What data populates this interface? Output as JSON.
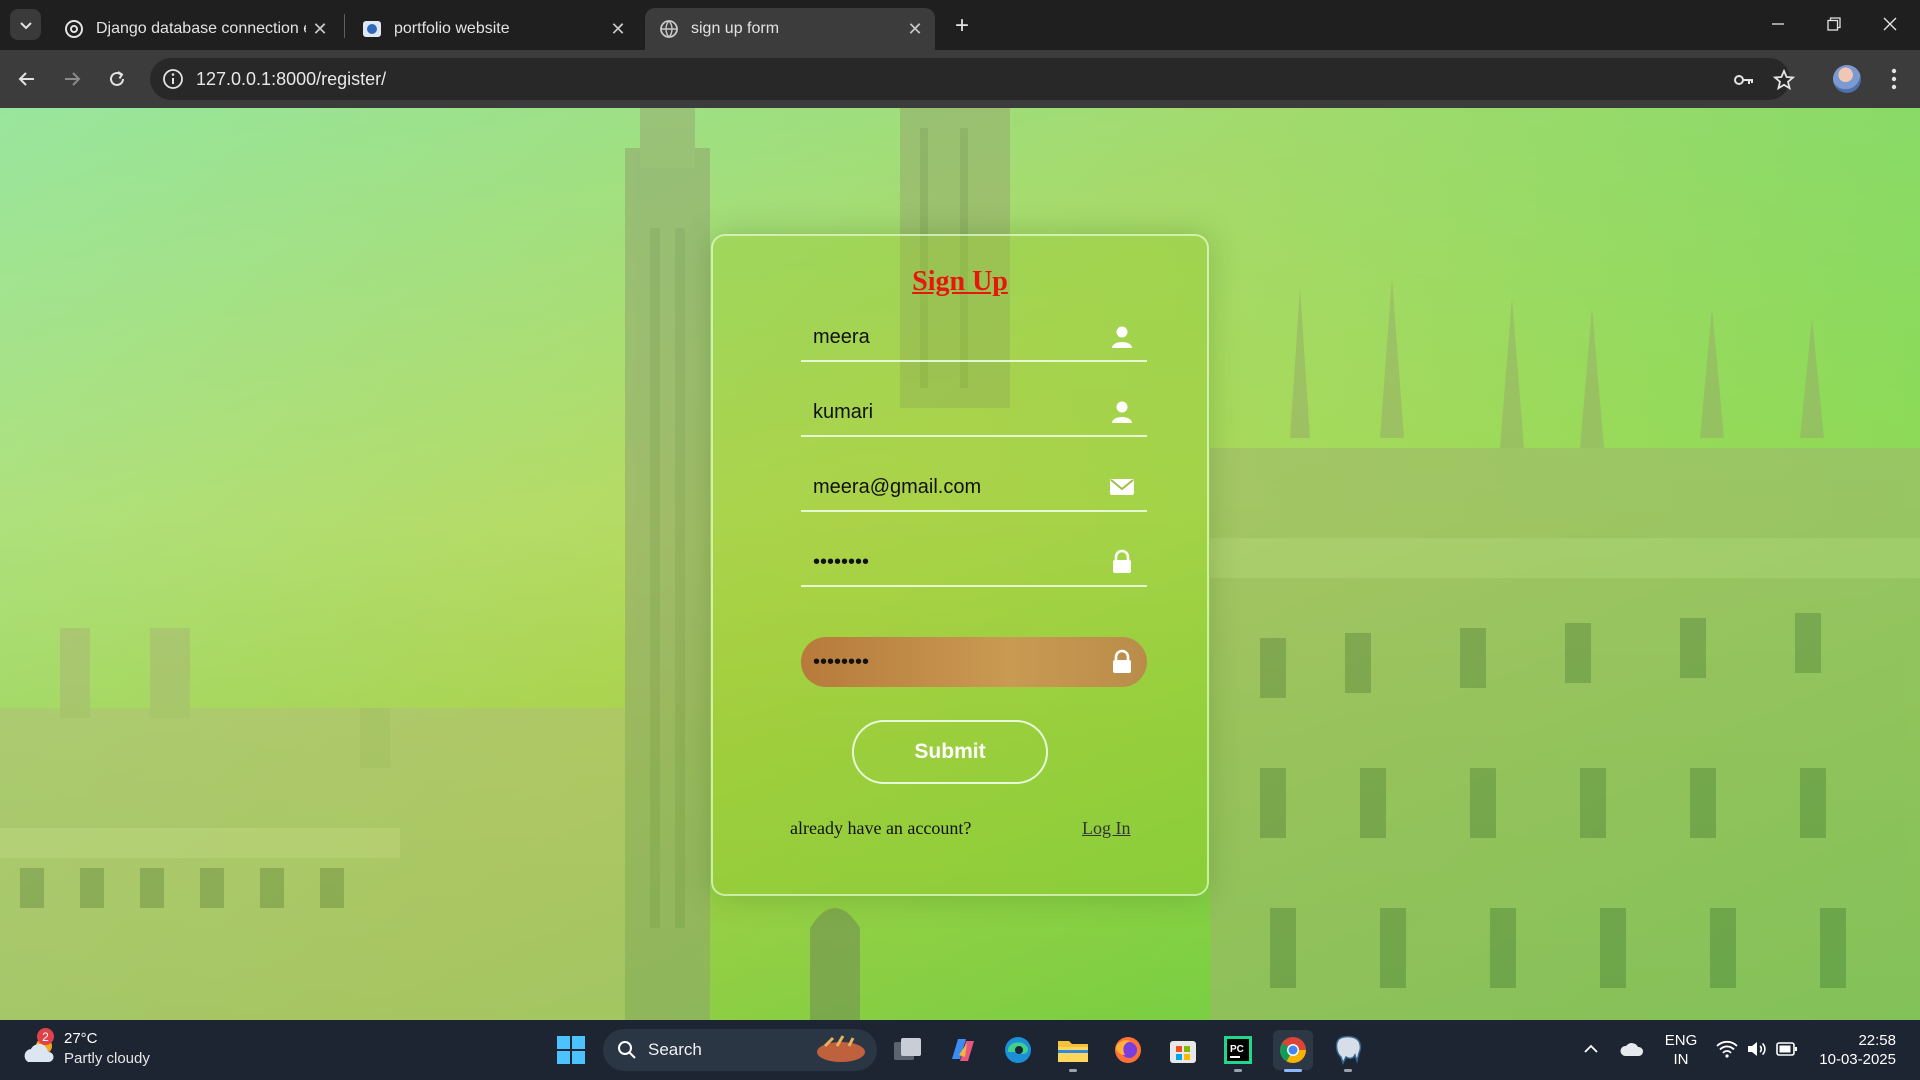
{
  "browser": {
    "tabs": [
      {
        "title": "Django database connection er",
        "favicon": "openai-icon",
        "active": false
      },
      {
        "title": "portfolio website",
        "favicon": "site-icon",
        "active": false
      },
      {
        "title": "sign up form",
        "favicon": "globe-icon",
        "active": true
      }
    ],
    "url": "127.0.0.1:8000/register/"
  },
  "form": {
    "title": "Sign Up",
    "fields": [
      {
        "value": "meera",
        "icon": "user-icon"
      },
      {
        "value": "kumari",
        "icon": "user-icon"
      },
      {
        "value": "meera@gmail.com",
        "icon": "envelope-icon"
      },
      {
        "value": "••••••••",
        "icon": "lock-icon"
      },
      {
        "value": "••••••••",
        "icon": "lock-icon"
      }
    ],
    "submit_label": "Submit",
    "account_prompt": "already have an account?",
    "login_link": "Log In"
  },
  "taskbar": {
    "weather": {
      "temp": "27°C",
      "condition": "Partly cloudy",
      "badge": "2"
    },
    "search_label": "Search",
    "language": {
      "line1": "ENG",
      "line2": "IN"
    },
    "time": "22:58",
    "date": "10-03-2025"
  }
}
